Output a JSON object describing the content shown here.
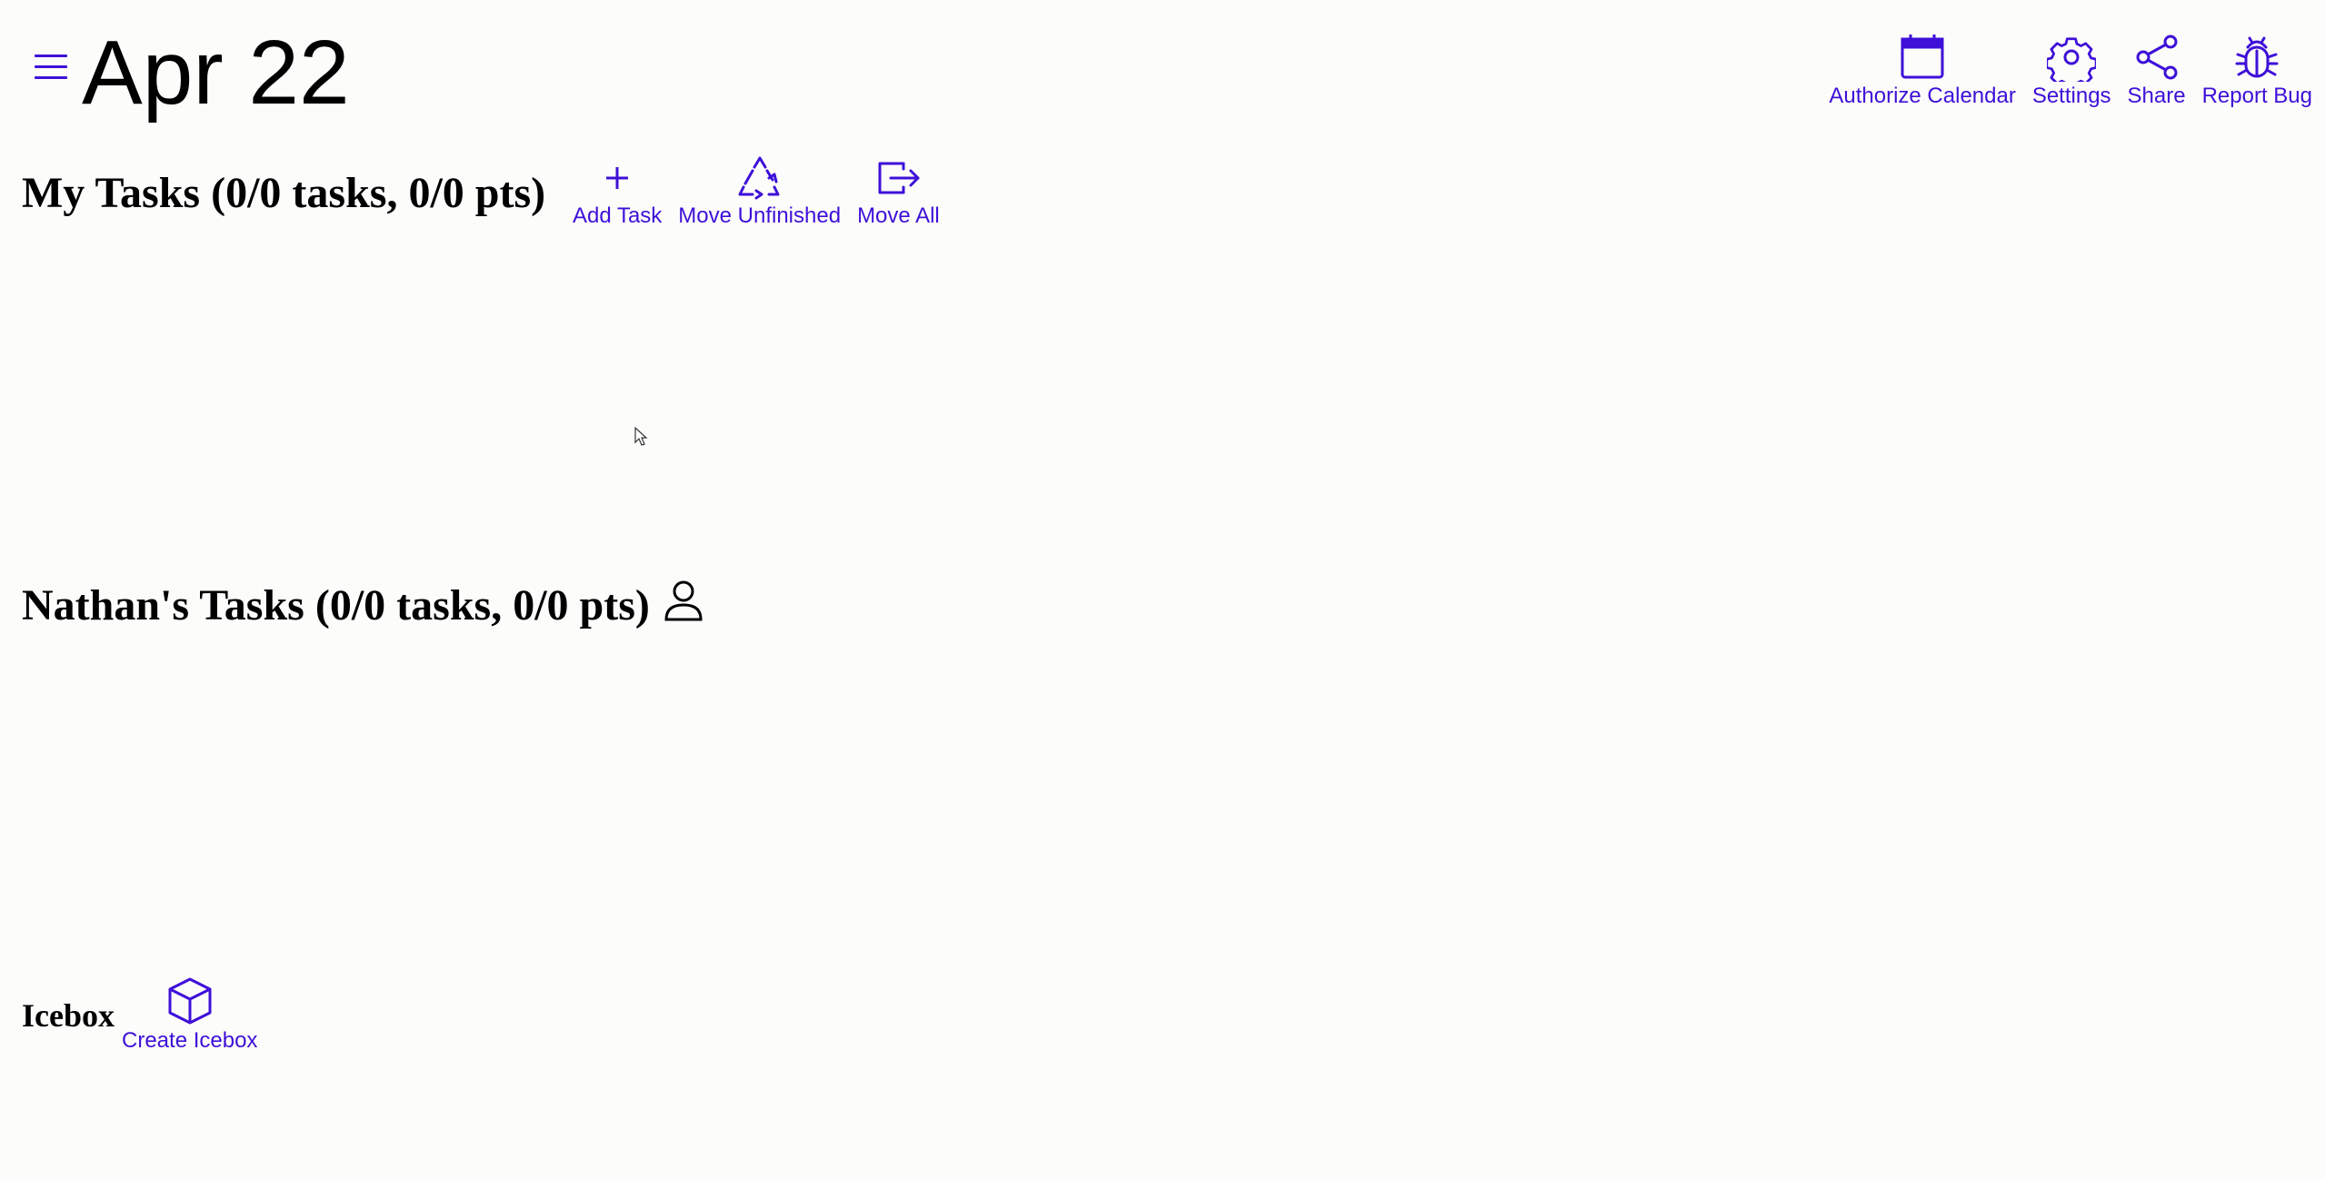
{
  "header": {
    "menu_icon": "hamburger-menu-icon",
    "date": "Apr 22"
  },
  "top_actions": [
    {
      "name": "authorize-calendar-button",
      "icon": "calendar-icon",
      "label": "Authorize Calendar"
    },
    {
      "name": "settings-button",
      "icon": "gear-icon",
      "label": "Settings"
    },
    {
      "name": "share-button",
      "icon": "share-icon",
      "label": "Share"
    },
    {
      "name": "report-bug-button",
      "icon": "bug-icon",
      "label": "Report Bug"
    }
  ],
  "my_tasks": {
    "title": "My Tasks (0/0 tasks, 0/0 pts)",
    "tasks": [],
    "actions": [
      {
        "name": "add-task-button",
        "icon": "plus-icon",
        "label": "Add Task"
      },
      {
        "name": "move-unfinished-button",
        "icon": "recycle-icon",
        "label": "Move Unfinished"
      },
      {
        "name": "move-all-button",
        "icon": "move-out-icon",
        "label": "Move All"
      }
    ]
  },
  "nathan_tasks": {
    "title": "Nathan's Tasks (0/0 tasks, 0/0 pts)",
    "icon": "person-icon",
    "tasks": []
  },
  "icebox": {
    "title": "Icebox",
    "create_label": "Create Icebox",
    "icon": "cube-icon"
  },
  "colors": {
    "accent": "#3e10d8",
    "background": "#fcfcfb",
    "text": "#000000"
  }
}
